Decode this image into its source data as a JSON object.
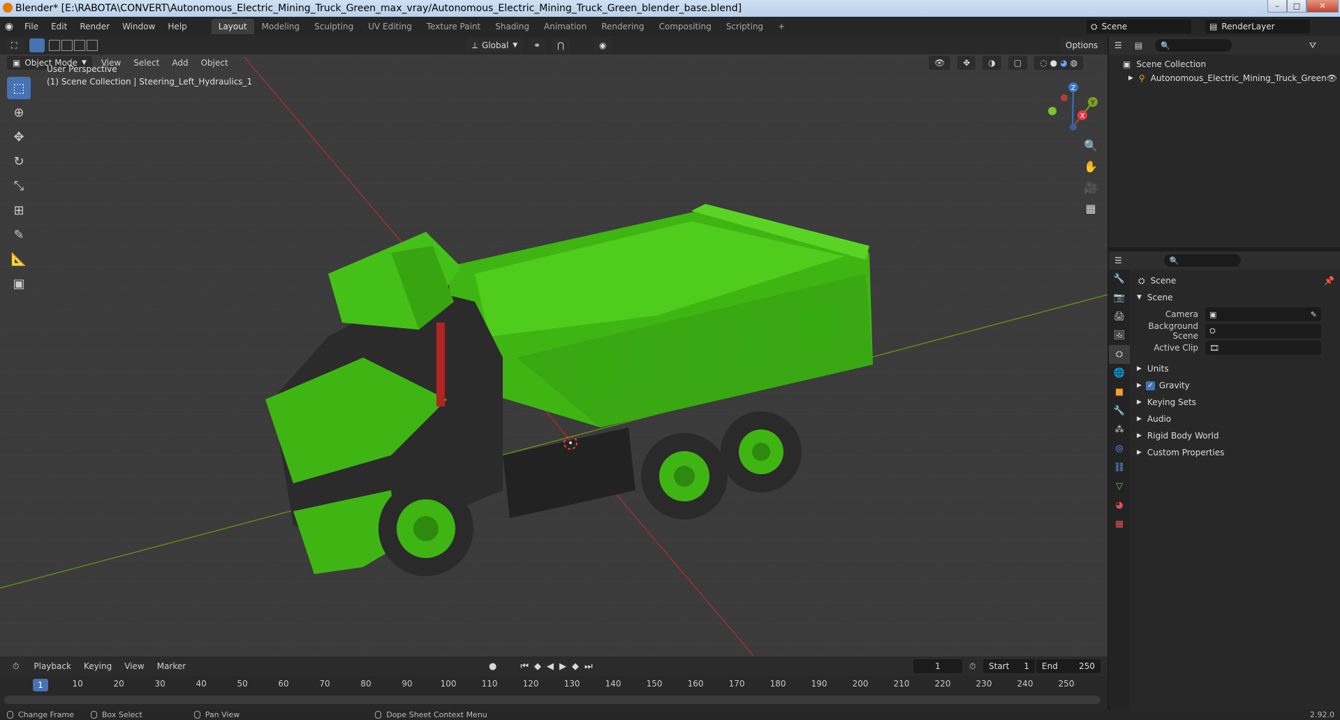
{
  "window": {
    "title": "Blender* [E:\\RABOTA\\CONVERT\\Autonomous_Electric_Mining_Truck_Green_max_vray/Autonomous_Electric_Mining_Truck_Green_blender_base.blend]",
    "minimize": "–",
    "maximize": "□",
    "close": "✕"
  },
  "menu": [
    "File",
    "Edit",
    "Render",
    "Window",
    "Help"
  ],
  "workspaces": [
    "Layout",
    "Modeling",
    "Sculpting",
    "UV Editing",
    "Texture Paint",
    "Shading",
    "Animation",
    "Rendering",
    "Compositing",
    "Scripting"
  ],
  "active_workspace": "Layout",
  "add_workspace": "+",
  "scene_name": "Scene",
  "render_layer": "RenderLayer",
  "viewport": {
    "mode": "Object Mode",
    "menus": [
      "View",
      "Select",
      "Add",
      "Object"
    ],
    "orientation": "Global",
    "options_label": "Options",
    "perspective_label": "User Perspective",
    "collection_label": "(1) Scene Collection | Steering_Left_Hydraulics_1",
    "gizmo_axes": [
      "X",
      "Y",
      "Z"
    ]
  },
  "outliner": {
    "root": "Scene Collection",
    "items": [
      "Autonomous_Electric_Mining_Truck_Green"
    ]
  },
  "properties": {
    "context_title": "Scene",
    "section_title": "Scene",
    "fields": [
      {
        "label": "Camera",
        "value": ""
      },
      {
        "label": "Background Scene",
        "value": ""
      },
      {
        "label": "Active Clip",
        "value": ""
      }
    ],
    "panels": [
      "Units",
      "Gravity",
      "Keying Sets",
      "Audio",
      "Rigid Body World",
      "Custom Properties"
    ],
    "gravity_checked": true
  },
  "timeline": {
    "menus": [
      "Playback",
      "Keying",
      "View",
      "Marker"
    ],
    "current_frame": "1",
    "start_label": "Start",
    "start_value": "1",
    "end_label": "End",
    "end_value": "250",
    "ruler_labels": [
      "1",
      "10",
      "20",
      "30",
      "40",
      "50",
      "60",
      "70",
      "80",
      "90",
      "100",
      "110",
      "120",
      "130",
      "140",
      "150",
      "160",
      "170",
      "180",
      "190",
      "200",
      "210",
      "220",
      "230",
      "240",
      "250"
    ]
  },
  "statusbar": {
    "items": [
      "Change Frame",
      "Box Select",
      "Pan View",
      "Dope Sheet Context Menu"
    ],
    "version": "2.92.0"
  },
  "colors": {
    "truck_green": "#3fb514",
    "accent_blue": "#4772b3",
    "axis_red": "#c0392b",
    "axis_green": "#6e9e1e"
  }
}
